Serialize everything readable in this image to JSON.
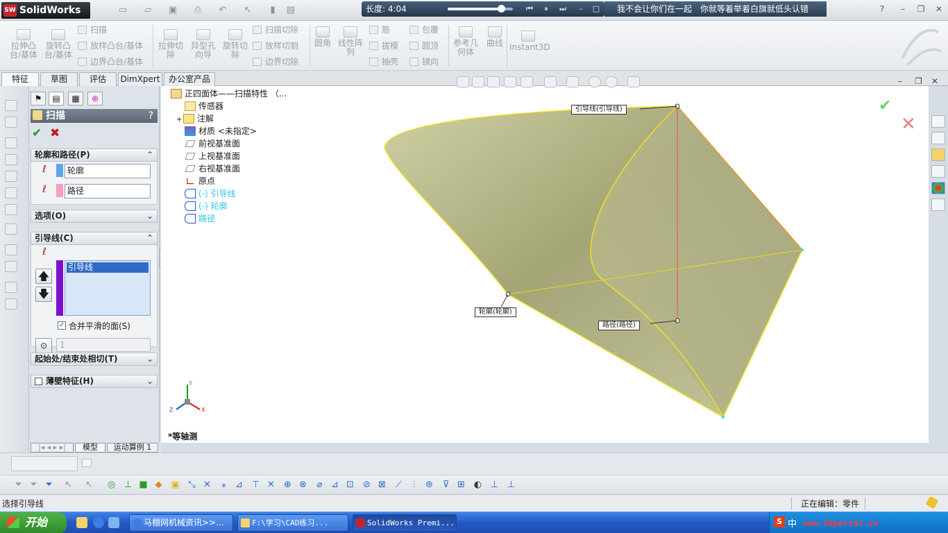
{
  "titlebar": {
    "app_name": "SolidWorks",
    "app_badge": "SW",
    "media": {
      "time": "长度: 4:04",
      "progress": 0.82
    },
    "lyric": {
      "left": "我不会让你们在一起",
      "right": "你就等着举着白旗就低头认错"
    },
    "help": "?"
  },
  "ribbon": {
    "big": [
      {
        "label": "拉伸凸台/基体"
      },
      {
        "label": "旋转凸台/基体"
      },
      {
        "label": "拉伸切除"
      },
      {
        "label": "异型孔向导"
      },
      {
        "label": "旋转切除"
      },
      {
        "label": "圆角"
      },
      {
        "label": "线性阵列"
      },
      {
        "label": "参考几何体"
      },
      {
        "label": "曲线"
      },
      {
        "label": "Instant3D"
      }
    ],
    "small_a": [
      "扫描",
      "放样凸台/基体",
      "边界凸台/基体"
    ],
    "small_b": [
      "扫描切除",
      "放样切割",
      "边界切除"
    ],
    "small_c": [
      "筋",
      "拔模",
      "抽壳"
    ],
    "small_d": [
      "包覆",
      "圆顶",
      "镜向"
    ]
  },
  "tabs": [
    "特征",
    "草图",
    "评估",
    "DimXpert",
    "办公室产品"
  ],
  "panel": {
    "title": "扫描",
    "help": "?",
    "ok": "✔",
    "cancel": "✖",
    "section_profile": "轮廓和路径(P)",
    "profile_value": "轮廓",
    "path_value": "路径",
    "section_options": "选项(O)",
    "section_guides": "引导线(C)",
    "guide_item": "引导线",
    "merge_label": "合并平滑的面(S)",
    "spin_value": "1",
    "section_tangency": "起始处/结束处相切(T)",
    "section_thin": "薄壁特征(H)"
  },
  "tree": {
    "root": "正四面体——扫描特性 （...",
    "items": [
      "传感器",
      "注解",
      "材质 <未指定>",
      "前视基准面",
      "上视基准面",
      "右视基准面",
      "原点",
      "(-) 引导线",
      "(-) 轮廓",
      "路径"
    ]
  },
  "viewport": {
    "labels": {
      "guide": "引导线(引导线)",
      "profile": "轮廓(轮廓)",
      "path": "路径(路径)"
    },
    "view_name": "*等轴测",
    "axes": {
      "x": "X",
      "y": "Y",
      "z": "Z"
    }
  },
  "bottom_tabs": [
    "模型",
    "运动算例 1"
  ],
  "status": {
    "left": "选择引导线",
    "right": "正在编辑：零件"
  },
  "taskbar": {
    "start": "开始",
    "items": [
      "马棚网机械资讯>>...",
      "F:\\学习\\CAD练习...",
      "SolidWorks Premi..."
    ],
    "tray_text": "中",
    "watermark": "www.3dportal.cn"
  },
  "colors": {
    "accent_shape": "#b3b38a",
    "edge": "#f0e020",
    "guide_line": "#e05050",
    "profile_swatch": "#5fa7e8",
    "path_swatch": "#f0a0c0"
  }
}
